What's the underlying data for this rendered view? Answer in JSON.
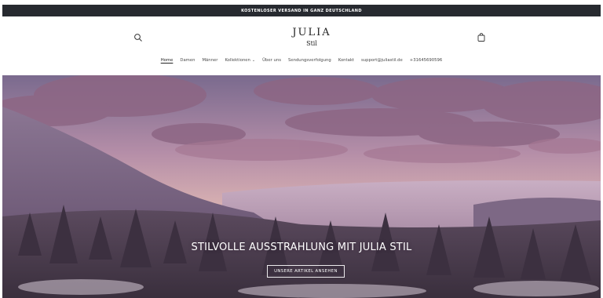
{
  "announcement": {
    "text": "KOSTENLOSER VERSAND IN GANZ DEUTSCHLAND"
  },
  "header": {
    "logo_line1": "JULIA",
    "logo_line2": "Stil",
    "search_icon": "search-icon",
    "cart_icon": "shopping-bag-icon"
  },
  "nav": {
    "items": [
      {
        "label": "Home",
        "active": true
      },
      {
        "label": "Damen"
      },
      {
        "label": "Männer"
      },
      {
        "label": "Kollektionen",
        "has_dropdown": true
      },
      {
        "label": "Über uns"
      },
      {
        "label": "Sendungsverfolgung"
      },
      {
        "label": "Kontakt"
      },
      {
        "label": "support@juliastil.de"
      },
      {
        "label": "+31645690596"
      }
    ]
  },
  "hero": {
    "title": "STILVOLLE AUSSTRAHLUNG MIT JULIA STIL",
    "button_label": "UNSERE ARTIKEL ANSEHEN"
  },
  "colors": {
    "announcement_bg": "#272a30",
    "sky_top": "#7d6a8c",
    "sky_glow": "#d6a7a4",
    "cloud": "#9a6f8a",
    "forest": "#3f3442",
    "snow": "#e8dfe8"
  }
}
